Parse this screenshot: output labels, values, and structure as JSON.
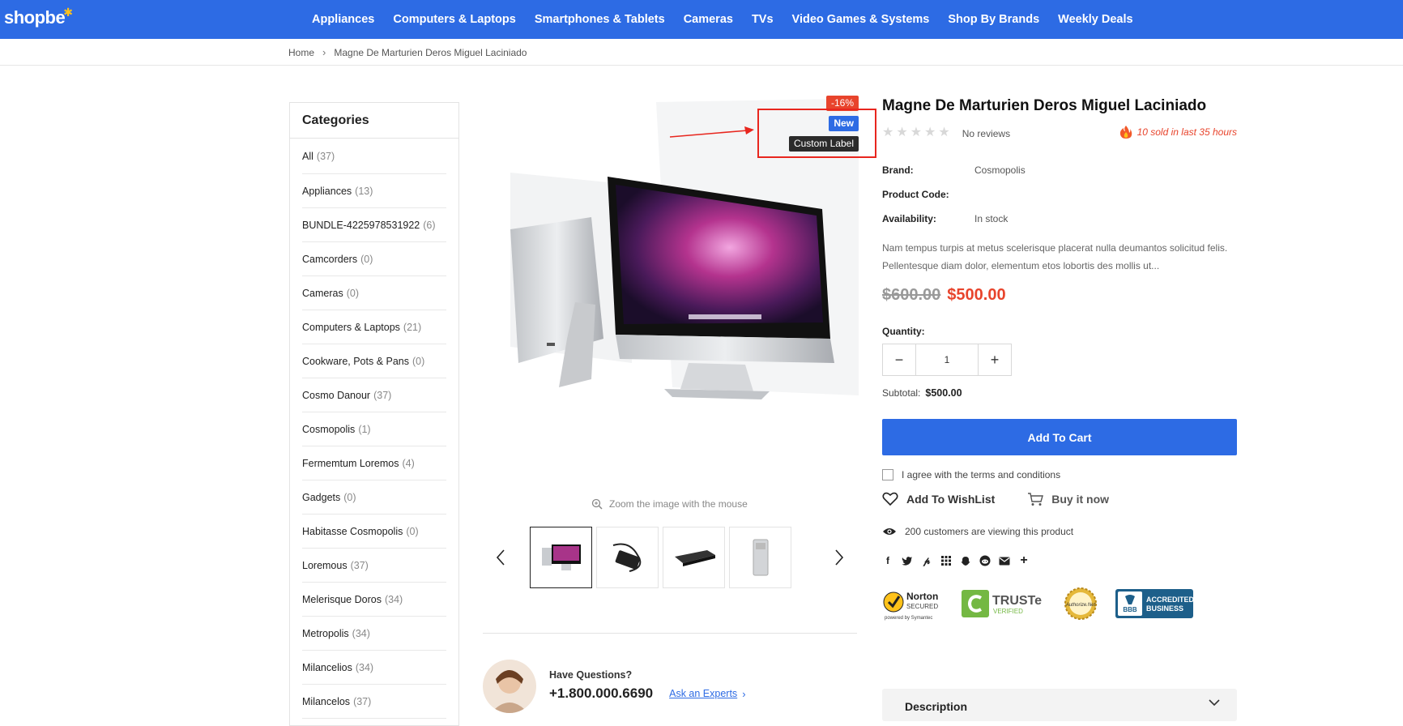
{
  "header": {
    "logo": "shopbe",
    "nav": [
      "Appliances",
      "Computers & Laptops",
      "Smartphones & Tablets",
      "Cameras",
      "TVs",
      "Video Games & Systems",
      "Shop By Brands",
      "Weekly Deals"
    ]
  },
  "breadcrumb": {
    "home": "Home",
    "current": "Magne De Marturien Deros Miguel Laciniado"
  },
  "sidebar": {
    "title": "Categories",
    "items": [
      {
        "label": "All",
        "count": "(37)"
      },
      {
        "label": "Appliances",
        "count": "(13)"
      },
      {
        "label": "BUNDLE-4225978531922",
        "count": "(6)"
      },
      {
        "label": "Camcorders",
        "count": "(0)"
      },
      {
        "label": "Cameras",
        "count": "(0)"
      },
      {
        "label": "Computers & Laptops",
        "count": "(21)"
      },
      {
        "label": "Cookware, Pots & Pans",
        "count": "(0)"
      },
      {
        "label": "Cosmo Danour",
        "count": "(37)"
      },
      {
        "label": "Cosmopolis",
        "count": "(1)"
      },
      {
        "label": "Fermemtum Loremos",
        "count": "(4)"
      },
      {
        "label": "Gadgets",
        "count": "(0)"
      },
      {
        "label": "Habitasse Cosmopolis",
        "count": "(0)"
      },
      {
        "label": "Loremous",
        "count": "(37)"
      },
      {
        "label": "Melerisque Doros",
        "count": "(34)"
      },
      {
        "label": "Metropolis",
        "count": "(34)"
      },
      {
        "label": "Milancelios",
        "count": "(34)"
      },
      {
        "label": "Milancelos",
        "count": "(37)"
      }
    ]
  },
  "gallery": {
    "badge_sale": "-16%",
    "badge_new": "New",
    "badge_custom": "Custom Label",
    "zoom_hint": "Zoom the image with the mouse"
  },
  "support": {
    "question": "Have Questions?",
    "phone": "+1.800.000.6690",
    "ask": "Ask an Experts"
  },
  "product": {
    "title": "Magne De Marturien Deros Miguel Laciniado",
    "reviews": "No reviews",
    "sold": "10 sold in last 35 hours",
    "brand_label": "Brand:",
    "brand": "Cosmopolis",
    "code_label": "Product Code:",
    "code": "",
    "availability_label": "Availability:",
    "availability": "In stock",
    "description": "Nam tempus turpis at metus scelerisque placerat nulla deumantos solicitud felis. Pellentesque diam dolor, elementum etos lobortis des mollis ut...",
    "old_price": "$600.00",
    "price": "$500.00",
    "quantity_label": "Quantity:",
    "quantity": "1",
    "subtotal_label": "Subtotal:",
    "subtotal": "$500.00",
    "add_to_cart": "Add To Cart",
    "agree": "I agree with the terms and conditions",
    "wishlist": "Add To WishList",
    "buy_now": "Buy it now",
    "viewing": "200 customers are viewing this product",
    "description_tab": "Description"
  },
  "colors": {
    "brand_blue": "#2d6be4",
    "sale_red": "#e8442c",
    "annotation_red": "#e8261e"
  }
}
